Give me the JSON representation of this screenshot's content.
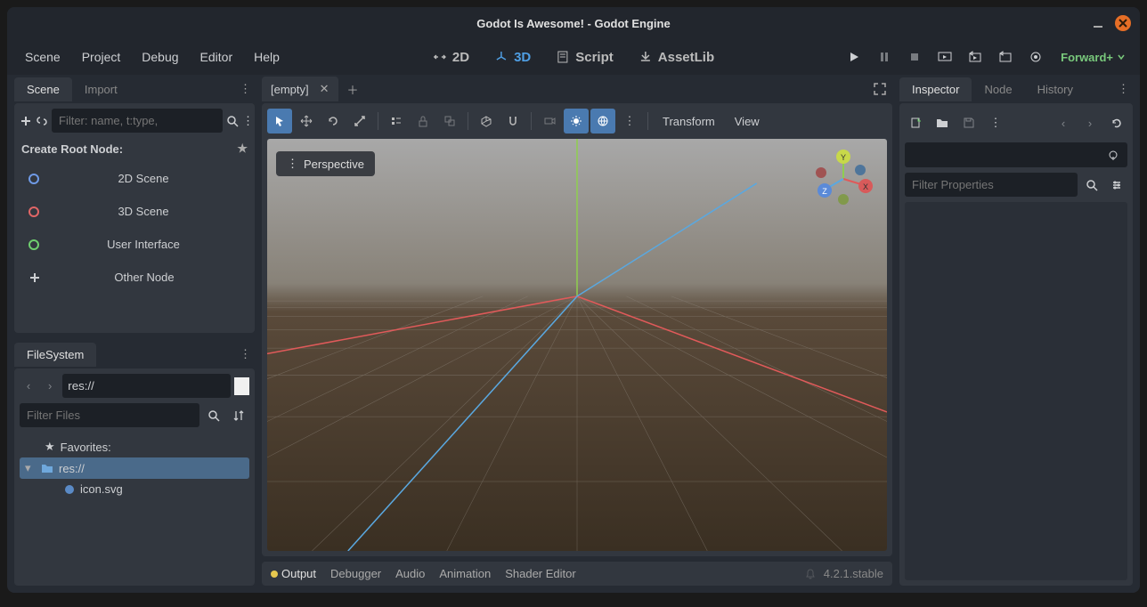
{
  "window": {
    "title": "Godot Is Awesome! - Godot Engine"
  },
  "menu": {
    "items": [
      "Scene",
      "Project",
      "Debug",
      "Editor",
      "Help"
    ]
  },
  "modes": {
    "m2d": "2D",
    "m3d": "3D",
    "script": "Script",
    "assetlib": "AssetLib",
    "active": "3D"
  },
  "renderer": {
    "label": "Forward+"
  },
  "scene_panel": {
    "tabs": {
      "scene": "Scene",
      "import": "Import"
    },
    "filter_placeholder": "Filter: name, t:type,",
    "create_root": "Create Root Node:",
    "btn_2d": "2D Scene",
    "btn_3d": "3D Scene",
    "btn_ui": "User Interface",
    "btn_other": "Other Node"
  },
  "filesystem": {
    "tab": "FileSystem",
    "path": "res://",
    "filter_placeholder": "Filter Files",
    "favorites": "Favorites:",
    "root": "res://",
    "file1": "icon.svg"
  },
  "center": {
    "tab_empty": "[empty]",
    "perspective": "Perspective",
    "transform": "Transform",
    "view": "View"
  },
  "bottom": {
    "output": "Output",
    "debugger": "Debugger",
    "audio": "Audio",
    "animation": "Animation",
    "shader": "Shader Editor",
    "version": "4.2.1.stable"
  },
  "inspector": {
    "tabs": {
      "inspector": "Inspector",
      "node": "Node",
      "history": "History"
    },
    "filter_placeholder": "Filter Properties"
  },
  "gizmo": {
    "x": "X",
    "y": "Y",
    "z": "Z"
  }
}
